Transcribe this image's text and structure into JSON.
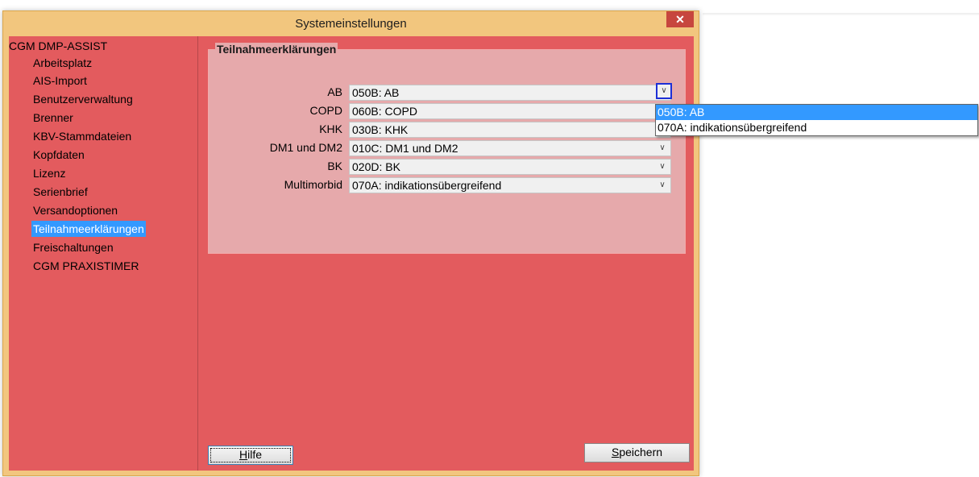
{
  "window": {
    "title": "Systemeinstellungen",
    "close_label": "✕"
  },
  "tree": {
    "root": "CGM DMP-ASSIST",
    "items": [
      "Arbeitsplatz",
      "AIS-Import",
      "Benutzerverwaltung",
      "Brenner",
      "KBV-Stammdateien",
      "Kopfdaten",
      "Lizenz",
      "Serienbrief",
      "Versandoptionen",
      "Teilnahmeerklärungen",
      "Freischaltungen",
      "CGM PRAXISTIMER"
    ],
    "selected": "Teilnahmeerklärungen"
  },
  "group": {
    "title": "Teilnahmeerklärungen",
    "rows": [
      {
        "label": "AB",
        "value": "050B: AB"
      },
      {
        "label": "COPD",
        "value": "060B: COPD"
      },
      {
        "label": "KHK",
        "value": "030B: KHK"
      },
      {
        "label": "DM1 und DM2",
        "value": "010C: DM1 und DM2"
      },
      {
        "label": "BK",
        "value": "020D: BK"
      },
      {
        "label": "Multimorbid",
        "value": "070A: indikationsübergreifend"
      }
    ]
  },
  "dropdown": {
    "options": [
      "050B: AB",
      "070A: indikationsübergreifend"
    ],
    "highlighted": "050B: AB"
  },
  "buttons": {
    "help_first": "H",
    "help_rest": "ilfe",
    "save_first": "S",
    "save_rest": "peichern"
  },
  "icons": {
    "dropdown_arrow": "chevron-down-icon",
    "close": "close-icon"
  },
  "colors": {
    "client_bg": "#e35b5e",
    "frame": "#f2c67e",
    "selection": "#3399ff",
    "close": "#c7463e"
  }
}
